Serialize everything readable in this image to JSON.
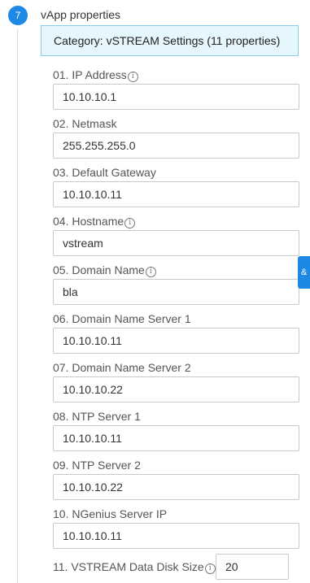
{
  "step": {
    "number": "7",
    "title": "vApp properties"
  },
  "category": {
    "label": "Category: vSTREAM Settings (11 properties)"
  },
  "properties": [
    {
      "label": "01. IP Address",
      "value": "10.10.10.1",
      "info": true
    },
    {
      "label": "02. Netmask",
      "value": "255.255.255.0",
      "info": false
    },
    {
      "label": "03. Default Gateway",
      "value": "10.10.10.11",
      "info": false
    },
    {
      "label": "04. Hostname",
      "value": "vstream",
      "info": true
    },
    {
      "label": "05. Domain Name",
      "value": "bla",
      "info": true
    },
    {
      "label": "06. Domain Name Server 1",
      "value": "10.10.10.11",
      "info": false
    },
    {
      "label": "07. Domain Name Server 2",
      "value": "10.10.10.22",
      "info": false
    },
    {
      "label": "08. NTP Server 1",
      "value": "10.10.10.11",
      "info": false
    },
    {
      "label": "09. NTP Server 2",
      "value": "10.10.10.22",
      "info": false
    },
    {
      "label": "10. NGenius Server IP",
      "value": "10.10.10.11",
      "info": false
    },
    {
      "label": "11. VSTREAM Data Disk Size",
      "value": "20",
      "info": true
    }
  ],
  "side_tab": {
    "icon": "chat-icon",
    "glyph": "&"
  },
  "colors": {
    "accent": "#1e88e5",
    "category_bg": "#e5f6fd",
    "category_border": "#8ecde6"
  }
}
